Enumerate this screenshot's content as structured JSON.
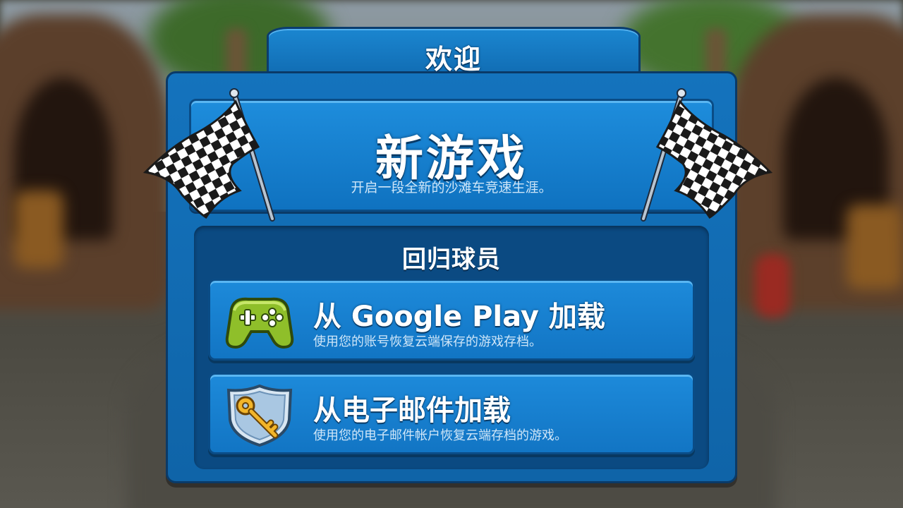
{
  "header": {
    "title": "欢迎"
  },
  "new_game": {
    "title": "新游戏",
    "subtitle": "开启一段全新的沙滩车竞速生涯。"
  },
  "returning": {
    "title": "回归球员",
    "options": [
      {
        "title": "从 Google Play 加载",
        "subtitle": "使用您的账号恢复云端保存的游戏存档。",
        "icon": "gamepad-icon"
      },
      {
        "title": "从电子邮件加载",
        "subtitle": "使用您的电子邮件帐户恢复云端存档的游戏。",
        "icon": "key-shield-icon"
      }
    ]
  },
  "colors": {
    "panel": "#1473bd",
    "border": "#0a3a68",
    "button": "#1d8ada",
    "text": "#ffffff",
    "subtext": "#cfe6f8"
  }
}
